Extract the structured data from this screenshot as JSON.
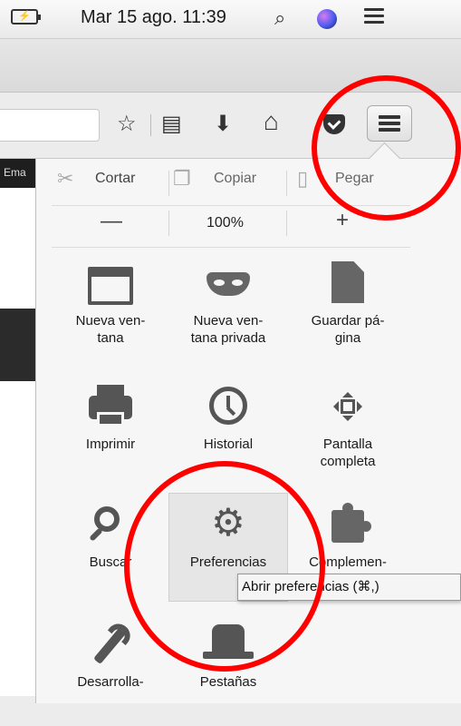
{
  "menubar": {
    "battery_label": "⚡",
    "clock": "Mar 15 ago. 11:39",
    "search_icon": "search-icon",
    "siri_icon": "siri-icon",
    "list_icon": "notification-list-icon"
  },
  "toolbar": {
    "icons": [
      "star-icon",
      "reading-list-icon",
      "download-icon",
      "home-icon",
      "pocket-icon",
      "hamburger-menu-icon"
    ],
    "star": "☆",
    "reading": "▤",
    "download": "⬇",
    "home": "⌂"
  },
  "page": {
    "behind_text": "Ema"
  },
  "menu": {
    "edit": {
      "cut": "Cortar",
      "copy": "Copiar",
      "paste": "Pegar"
    },
    "zoom": {
      "minus": "—",
      "level": "100%",
      "plus": "+"
    },
    "tiles": [
      {
        "label": "Nueva ven-\ntana",
        "icon": "new-window-icon"
      },
      {
        "label": "Nueva ven-\ntana privada",
        "icon": "private-window-mask-icon"
      },
      {
        "label": "Guardar pá-\ngina",
        "icon": "save-page-icon"
      },
      {
        "label": "Imprimir",
        "icon": "printer-icon"
      },
      {
        "label": "Historial",
        "icon": "history-clock-icon"
      },
      {
        "label": "Pantalla\ncompleta",
        "icon": "fullscreen-icon"
      },
      {
        "label": "Buscar",
        "icon": "search-magnifier-icon"
      },
      {
        "label": "Preferencias",
        "icon": "gear-icon"
      },
      {
        "label": "Complemen-",
        "icon": "addons-puzzle-icon"
      },
      {
        "label": "Desarrolla-",
        "icon": "developer-wrench-icon"
      },
      {
        "label": "Pestañas",
        "icon": "tabs-hat-icon"
      }
    ],
    "tooltip": "Abrir preferencias (⌘,)"
  },
  "colors": {
    "annotation": "#ff0000",
    "panel_bg": "#f6f6f6"
  }
}
